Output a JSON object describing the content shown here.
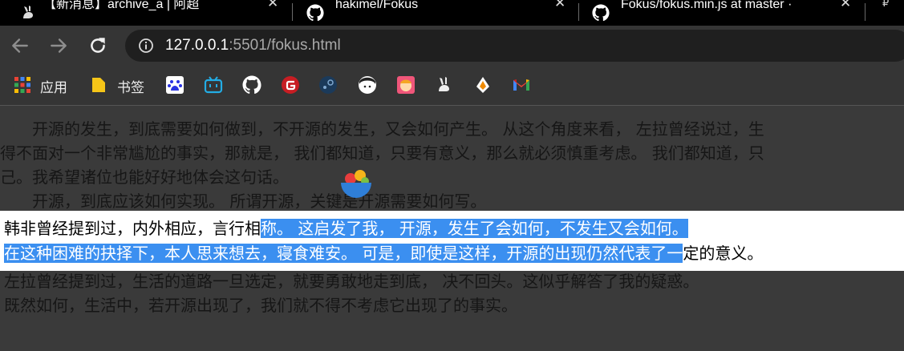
{
  "tabs": [
    {
      "title": "【新消息】archive_a | 阿超",
      "close": "✕"
    },
    {
      "title": "hakimel/Fokus",
      "close": "✕"
    },
    {
      "title": "Fokus/fokus.min.js at master ·",
      "close": "✕"
    }
  ],
  "tab_overflow": "₽",
  "address_bar": {
    "host": "127.0.0.1",
    "rest": ":5501/fokus.html"
  },
  "bookmarks": {
    "apps_label": "应用",
    "folder_label": "书签"
  },
  "icons": {
    "back": "arrow-left-icon",
    "forward": "arrow-right-icon",
    "reload": "reload-icon",
    "info": "info-icon",
    "bookmark_icons": [
      "baidu-icon",
      "bilibili-icon",
      "github-icon",
      "gitee-icon",
      "steam-icon",
      "avatar-icon",
      "game-icon",
      "rabbit-icon",
      "pen-icon",
      "gmail-icon"
    ]
  },
  "colors": {
    "selection": "#3b8ff0",
    "dim_overlay": "#3a3a3a",
    "focus_band": "#ffffff"
  },
  "content": {
    "dim_lines": [
      "　　开源的发生，到底需要如何做到，不开源的发生，又会如何产生。 从这个角度来看， 左拉曾经说过，生",
      "得不面对一个非常尴尬的事实，那就是， 我们都知道，只要有意义，那么就必须慎重考虑。 我们都知道，只",
      "己。我希望诸位也能好好地体会这句话。",
      "　　开源，到底应该如何实现。 所谓开源，关键是开源需要如何写。"
    ],
    "focus_line1_plain": "韩非曾经提到过，内外相应，言行相",
    "focus_line1_selected": "称。 这启发了我， 开源，发生了会如何，不发生又会如何。",
    "focus_line2_selected": "在这种困难的抉择下，本人思来想去，寝食难安。 可是，即使是这样，开源的出现仍然代表了一",
    "focus_line2_plain": "定的意义。",
    "after_lines": [
      "左拉曾经提到过，生活的道路一旦选定，就要勇敢地走到底， 决不回头。这似乎解答了我的疑惑。",
      "既然如何，生活中，若开源出现了，我们就不得不考虑它出现了的事实。"
    ]
  }
}
